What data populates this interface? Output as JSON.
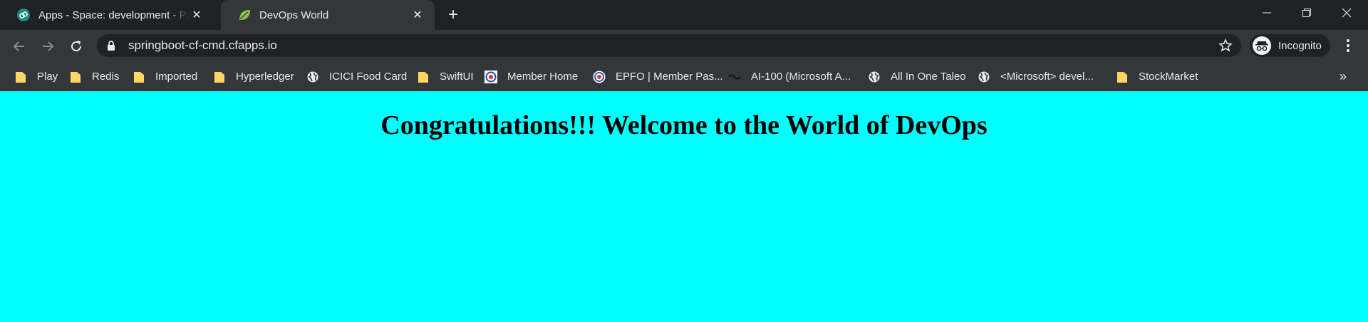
{
  "tabs": [
    {
      "title": "Apps - Space: development - Pivotal",
      "icon": "pivotal-icon",
      "active": false
    },
    {
      "title": "DevOps World",
      "icon": "spring-leaf-icon",
      "active": true
    }
  ],
  "toolbar": {
    "url": "springboot-cf-cmd.cfapps.io",
    "profile_label": "Incognito"
  },
  "bookmarks": [
    {
      "label": "Play",
      "icon": "folder-icon"
    },
    {
      "label": "Redis",
      "icon": "folder-icon"
    },
    {
      "label": "Imported",
      "icon": "folder-icon"
    },
    {
      "label": "Hyperledger",
      "icon": "folder-icon"
    },
    {
      "label": "ICICI Food Card",
      "icon": "globe-icon"
    },
    {
      "label": "SwiftUI",
      "icon": "folder-icon"
    },
    {
      "label": "Member Home",
      "icon": "epfo-icon"
    },
    {
      "label": "EPFO | Member Pas...",
      "icon": "epfo-icon"
    },
    {
      "label": "AI-100 (Microsoft A...",
      "icon": "site-icon"
    },
    {
      "label": "All In One Taleo",
      "icon": "globe-icon"
    },
    {
      "label": "<Microsoft> devel...",
      "icon": "globe-icon"
    },
    {
      "label": "StockMarket",
      "icon": "folder-icon"
    }
  ],
  "page": {
    "heading": "Congratulations!!! Welcome to the World of DevOps"
  },
  "colors": {
    "page_background": "#00ffff",
    "chrome_dark": "#202124",
    "chrome_toolbar": "#35363a",
    "folder": "#fdd663"
  }
}
